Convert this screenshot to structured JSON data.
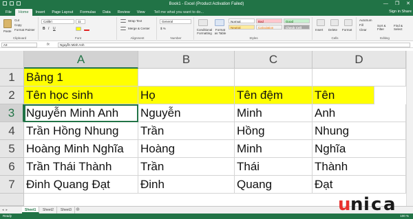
{
  "window": {
    "title": "Book1 - Excel (Product Activation Failed)",
    "controls": [
      "—",
      "❐",
      "✕"
    ]
  },
  "ribbon_tabs": [
    "File",
    "Home",
    "Insert",
    "Page Layout",
    "Formulas",
    "Data",
    "Review",
    "View"
  ],
  "active_tab": "Home",
  "tell_me": "Tell me what you want to do...",
  "sign_in": "Sign in",
  "share": "Share",
  "ribbon": {
    "clipboard": {
      "label": "Clipboard",
      "paste": "Paste",
      "cut": "Cut",
      "copy": "Copy",
      "format_painter": "Format Painter"
    },
    "font": {
      "label": "Font",
      "name": "Calibri",
      "size": "11"
    },
    "alignment": {
      "label": "Alignment",
      "wrap_text": "Wrap Text",
      "merge_center": "Merge & Center"
    },
    "number": {
      "label": "Number",
      "format": "General"
    },
    "styles": {
      "label": "Styles",
      "conditional": "Conditional Formatting",
      "format_table": "Format as Table",
      "cells": [
        "Normal",
        "Bad",
        "Good",
        "Neutral",
        "Calculation",
        "Check Cell"
      ]
    },
    "cells": {
      "label": "Cells",
      "insert": "Insert",
      "delete": "Delete",
      "format": "Format"
    },
    "editing": {
      "label": "Editing",
      "autosum": "AutoSum",
      "fill": "Fill",
      "clear": "Clear",
      "sort_filter": "Sort & Filter",
      "find_select": "Find & Select"
    }
  },
  "formula_bar": {
    "name_box": "A3",
    "fx": "fx",
    "content": "Nguyễn Minh Anh"
  },
  "columns": [
    "A",
    "B",
    "C",
    "D"
  ],
  "rows": [
    {
      "num": "1",
      "cells": [
        "Bảng 1",
        "",
        "",
        ""
      ]
    },
    {
      "num": "2",
      "cells": [
        "Tên học sinh",
        "Họ",
        "Tên đệm",
        "Tên"
      ]
    },
    {
      "num": "3",
      "cells": [
        "Nguyễn Minh Anh",
        "Nguyễn",
        "Minh",
        "Anh"
      ]
    },
    {
      "num": "4",
      "cells": [
        "Trần Hồng Nhung",
        "Trần",
        "Hồng",
        "Nhung"
      ]
    },
    {
      "num": "5",
      "cells": [
        "Hoàng Minh Nghĩa",
        "Hoàng",
        "Minh",
        "Nghĩa"
      ]
    },
    {
      "num": "6",
      "cells": [
        "Trần Thái Thành",
        "Trần",
        "Thái",
        "Thành"
      ]
    },
    {
      "num": "7",
      "cells": [
        "Đinh Quang Đạt",
        "Đinh",
        "Quang",
        "Đạt"
      ]
    }
  ],
  "sheets": [
    "Sheet1",
    "Sheet2",
    "Sheet3"
  ],
  "active_sheet": "Sheet1",
  "status": {
    "ready": "Ready",
    "zoom": "100 %"
  },
  "watermark": {
    "text": "unica",
    "colors": [
      "#e8302e",
      "#1a1a1a"
    ]
  },
  "colors": {
    "excel_green": "#217346",
    "highlight": "#ffff00"
  }
}
